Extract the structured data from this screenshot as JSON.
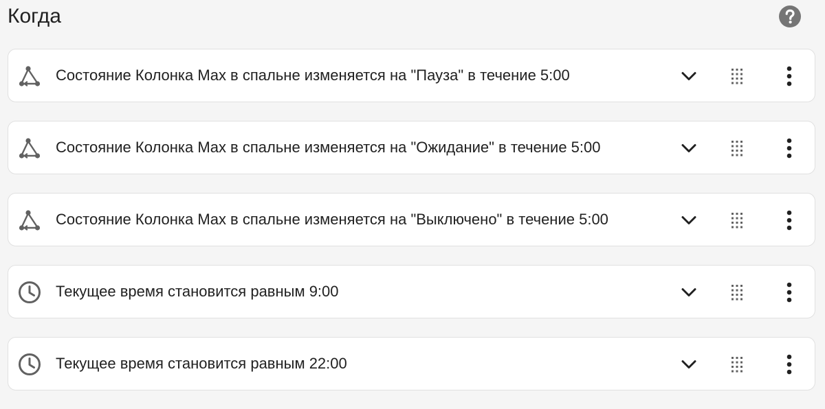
{
  "header": {
    "title": "Когда",
    "help_icon": "help-circle-icon"
  },
  "colors": {
    "icon": "#616161",
    "help": "#757575",
    "card_border": "#e0e0e0",
    "background": "#f5f5f5"
  },
  "triggers": [
    {
      "icon": "state-graph-icon",
      "label": "Состояние Колонка Max в спальне изменяется на \"Пауза\" в течение 5:00"
    },
    {
      "icon": "state-graph-icon",
      "label": "Состояние Колонка Max в спальне изменяется на \"Ожидание\" в течение 5:00"
    },
    {
      "icon": "state-graph-icon",
      "label": "Состояние Колонка Max в спальне изменяется на \"Выключено\" в течение 5:00"
    },
    {
      "icon": "clock-icon",
      "label": "Текущее время становится равным 9:00"
    },
    {
      "icon": "clock-icon",
      "label": "Текущее время становится равным 22:00"
    }
  ]
}
